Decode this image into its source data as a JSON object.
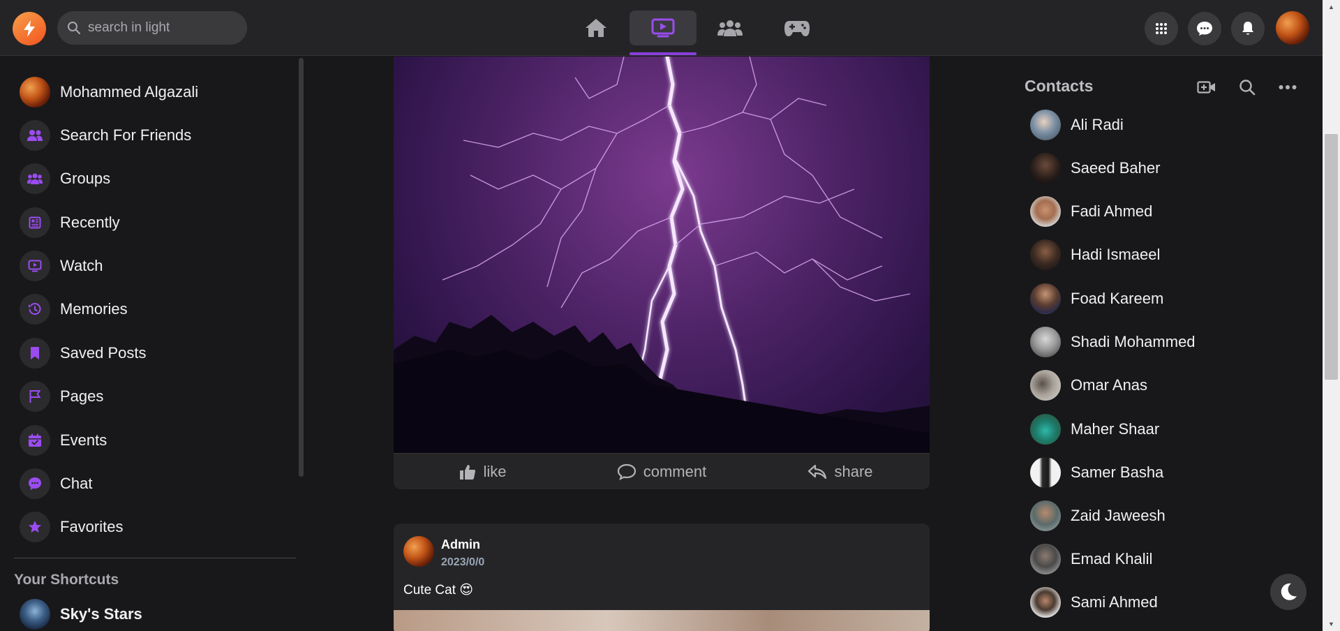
{
  "header": {
    "search_placeholder": "search in light",
    "active_tab_tooltip": "watch"
  },
  "sidebar": {
    "profile_name": "Mohammed Algazali",
    "items": [
      {
        "label": "Search For Friends",
        "icon": "friends-icon"
      },
      {
        "label": "Groups",
        "icon": "groups-icon"
      },
      {
        "label": "Recently",
        "icon": "newspaper-icon"
      },
      {
        "label": "Watch",
        "icon": "watch-icon"
      },
      {
        "label": "Memories",
        "icon": "history-icon"
      },
      {
        "label": "Saved Posts",
        "icon": "bookmark-icon"
      },
      {
        "label": "Pages",
        "icon": "flag-icon"
      },
      {
        "label": "Events",
        "icon": "calendar-icon"
      },
      {
        "label": "Chat",
        "icon": "chat-icon"
      },
      {
        "label": "Favorites",
        "icon": "star-icon"
      }
    ],
    "shortcuts_heading": "Your Shortcuts",
    "shortcuts": [
      {
        "label": "Sky's Stars"
      }
    ]
  },
  "feed": {
    "post1": {
      "actions": {
        "like": "like",
        "comment": "comment",
        "share": "share"
      }
    },
    "post2": {
      "author": "Admin",
      "date": "2023/0/0",
      "caption": "Cute Cat 😍"
    }
  },
  "contacts": {
    "title": "Contacts",
    "list": [
      {
        "name": "Ali Radi"
      },
      {
        "name": "Saeed Baher"
      },
      {
        "name": "Fadi Ahmed"
      },
      {
        "name": "Hadi Ismaeel"
      },
      {
        "name": "Foad Kareem"
      },
      {
        "name": "Shadi Mohammed"
      },
      {
        "name": "Omar Anas"
      },
      {
        "name": "Maher Shaar"
      },
      {
        "name": "Samer Basha"
      },
      {
        "name": "Zaid Jaweesh"
      },
      {
        "name": "Emad Khalil"
      },
      {
        "name": "Sami Ahmed"
      }
    ]
  },
  "colors": {
    "accent": "#8a3fe0",
    "background": "#18181a",
    "panel": "#242426"
  }
}
